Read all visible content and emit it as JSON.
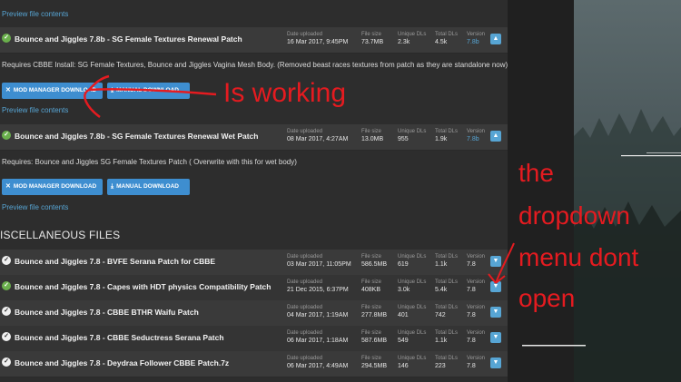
{
  "preview_link": "Preview file contents",
  "section_title": "ISCELLANEOUS FILES",
  "labels": {
    "date": "Date uploaded",
    "size": "File size",
    "unique": "Unique DLs",
    "total": "Total DLs",
    "version": "Version"
  },
  "buttons": {
    "mod_manager": "MOD MANAGER DOWNLOAD",
    "manual": "MANUAL DOWNLOAD"
  },
  "files": [
    {
      "name": "Bounce and Jiggles 7.8b - SG Female Textures Renewal Patch",
      "date": "16 Mar 2017, 9:45PM",
      "size": "73.7MB",
      "unique": "2.3k",
      "total": "4.5k",
      "version": "7.8b",
      "check": "green",
      "desc": "Requires CBBE Install: SG Female Textures, Bounce and Jiggles Vagina Mesh Body. (Removed beast races textures from patch as they are standalone now)"
    },
    {
      "name": "Bounce and Jiggles 7.8b - SG Female Textures Renewal Wet Patch",
      "date": "08 Mar 2017, 4:27AM",
      "size": "13.0MB",
      "unique": "955",
      "total": "1.9k",
      "version": "7.8b",
      "check": "green",
      "desc": "Requires: Bounce and Jiggles SG Female Textures Patch ( Overwrite with this for wet body)"
    },
    {
      "name": "Bounce and Jiggles 7.8 - BVFE Serana Patch for CBBE",
      "date": "03 Mar 2017, 11:05PM",
      "size": "586.5MB",
      "unique": "619",
      "total": "1.1k",
      "version": "7.8",
      "check": "white"
    },
    {
      "name": "Bounce and Jiggles 7.8 - Capes with HDT physics Compatibility Patch",
      "date": "21 Dec 2015, 6:37PM",
      "size": "408KB",
      "unique": "3.0k",
      "total": "5.4k",
      "version": "7.8",
      "check": "green"
    },
    {
      "name": "Bounce and Jiggles 7.8 - CBBE BTHR Waifu Patch",
      "date": "04 Mar 2017, 1:19AM",
      "size": "277.8MB",
      "unique": "401",
      "total": "742",
      "version": "7.8",
      "check": "white"
    },
    {
      "name": "Bounce and Jiggles 7.8 - CBBE Seductress Serana Patch",
      "date": "06 Mar 2017, 1:18AM",
      "size": "587.6MB",
      "unique": "549",
      "total": "1.1k",
      "version": "7.8",
      "check": "white"
    },
    {
      "name": "Bounce and Jiggles 7.8 - Deydraa Follower CBBE Patch.7z",
      "date": "06 Mar 2017, 4:49AM",
      "size": "294.5MB",
      "unique": "146",
      "total": "223",
      "version": "7.8",
      "check": "white"
    }
  ],
  "annotations": {
    "working": "Is working",
    "dropdown_1": "the",
    "dropdown_2": "dropdown",
    "dropdown_3": "menu dont",
    "dropdown_4": "open"
  },
  "colors": {
    "accent": "#3e8ed0",
    "link": "#57a5d4",
    "annotation": "#e51b20",
    "check_green": "#6ab04c"
  },
  "icons": {
    "check": "check-circle-icon",
    "mod_manager": "crossed-tools-icon",
    "manual": "download-icon",
    "toggle": "chevron-up-icon"
  }
}
